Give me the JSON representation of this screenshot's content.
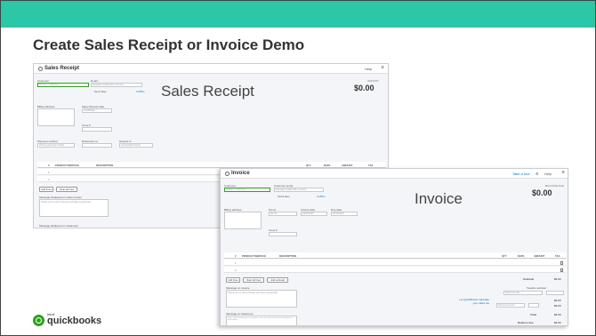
{
  "slide": {
    "title": "Create Sales Receipt or Invoice Demo",
    "accent": "#2bc7a7"
  },
  "sales_receipt": {
    "overlay_label": "Sales Receipt",
    "window_title": "Sales Receipt",
    "help": "Help",
    "customer_label": "Customer",
    "customer_placeholder": "Choose a customer",
    "email_label": "Email",
    "email_placeholder": "Separate emails with a comma",
    "send_later": "Send later",
    "ccbcc": "Cc/Bcc",
    "amount_label": "AMOUNT",
    "amount": "$0.00",
    "billing_label": "Billing address",
    "date_label": "Sales Receipt date",
    "date_value": "04/15/2020",
    "crew_label": "Crew #",
    "payment_label": "Payment method",
    "payment_placeholder": "Choose payment method",
    "reference_label": "Reference no.",
    "deposit_label": "Deposit to",
    "deposit_value": "Undeposited Funds",
    "table_headers": [
      "#",
      "PRODUCT/SERVICE",
      "DESCRIPTION",
      "QTY",
      "RATE",
      "AMOUNT",
      "TAX"
    ],
    "rows": [
      "1",
      "2"
    ],
    "add_lines": "Add lines",
    "clear_lines": "Clear all lines",
    "message_label": "Message displayed on sales receipt",
    "message_placeholder": "Thank you for your business and have a great day!",
    "statement_label": "Message displayed on statement"
  },
  "invoice": {
    "overlay_label": "Invoice",
    "window_title": "Invoice",
    "take_tour": "Take a tour",
    "help": "Help",
    "customer_label": "Customer",
    "customer_placeholder": "Choose a customer",
    "email_label": "Customer email",
    "email_placeholder": "Separate emails with a comma",
    "send_later": "Send later",
    "ccbcc": "Cc/Bcc",
    "balance_label": "BALANCE DUE",
    "amount": "$0.00",
    "billing_label": "Billing address",
    "terms_label": "Terms",
    "terms_value": "Net 30",
    "invoice_date_label": "Invoice date",
    "invoice_date_value": "04/15/2020",
    "due_date_label": "Due date",
    "due_date_value": "05/15/2020",
    "crew_label": "Crew #",
    "table_headers": [
      "#",
      "PRODUCT/SERVICE",
      "DESCRIPTION",
      "QTY",
      "RATE",
      "AMOUNT",
      "TAX"
    ],
    "rows": [
      "1",
      "2"
    ],
    "add_lines": "Add lines",
    "clear_lines": "Clear all lines",
    "add_subtotal": "Add subtotal",
    "message_label": "Message on invoice",
    "message_placeholder": "Thank you for your business and have a great day!",
    "statement_label": "Message on statement",
    "statement_placeholder": "If you send statements to customers, this will show up as the description for this invoice.",
    "link_text": "Let QuickBooks calculate your sales tax",
    "totals": [
      {
        "label": "Subtotal",
        "value": "$0.00"
      },
      {
        "label": "Taxable subtotal",
        "value": ""
      },
      {
        "label": "",
        "value": "$0.00"
      },
      {
        "label": "Discount percent",
        "value": "$0.00"
      },
      {
        "label": "Total",
        "value": "$0.00"
      },
      {
        "label": "Balance due",
        "value": "$0.00"
      }
    ],
    "tax_select": "Select tax rate",
    "discount_select": "Discount percent"
  },
  "logo": {
    "intuit": "intuit",
    "brand": "quickbooks",
    "brand_color": "#2ca01c"
  }
}
